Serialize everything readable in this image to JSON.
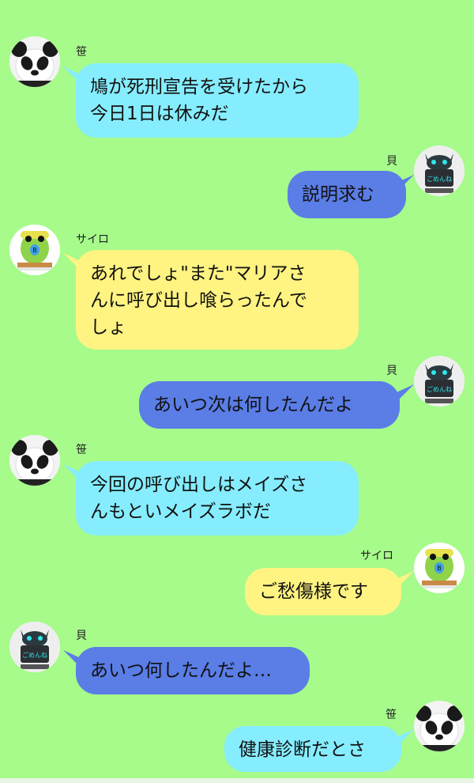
{
  "colors": {
    "background": "#a6fb8b",
    "bubble_cyan": "#86edff",
    "bubble_blue": "#5a7de6",
    "bubble_yellow": "#fff381"
  },
  "messages": [
    {
      "sender": "笹",
      "avatar": "panda-avatar",
      "side": "left",
      "text": "鳩が死刑宣告を受けたから\n今日1日は休みだ"
    },
    {
      "sender": "貝",
      "avatar": "robot-avatar",
      "side": "right",
      "text": "説明求む"
    },
    {
      "sender": "サイロ",
      "avatar": "parakeet-avatar",
      "side": "left",
      "text": "あれでしょ\"また\"マリアさ\nんに呼び出し喰らったんで\nしょ"
    },
    {
      "sender": "貝",
      "avatar": "robot-avatar",
      "side": "right",
      "text": "あいつ次は何したんだよ"
    },
    {
      "sender": "笹",
      "avatar": "panda-avatar",
      "side": "left",
      "text": "今回の呼び出しはメイズさ\nんもといメイズラボだ"
    },
    {
      "sender": "サイロ",
      "avatar": "parakeet-avatar",
      "side": "right",
      "text": "ご愁傷様です"
    },
    {
      "sender": "貝",
      "avatar": "robot-avatar",
      "side": "left",
      "text": "あいつ何したんだよ…"
    },
    {
      "sender": "笹",
      "avatar": "panda-avatar",
      "side": "right",
      "text": "健康診断だとさ"
    }
  ],
  "avatar_text": {
    "robot": "ごめんね",
    "parakeet": "B"
  }
}
